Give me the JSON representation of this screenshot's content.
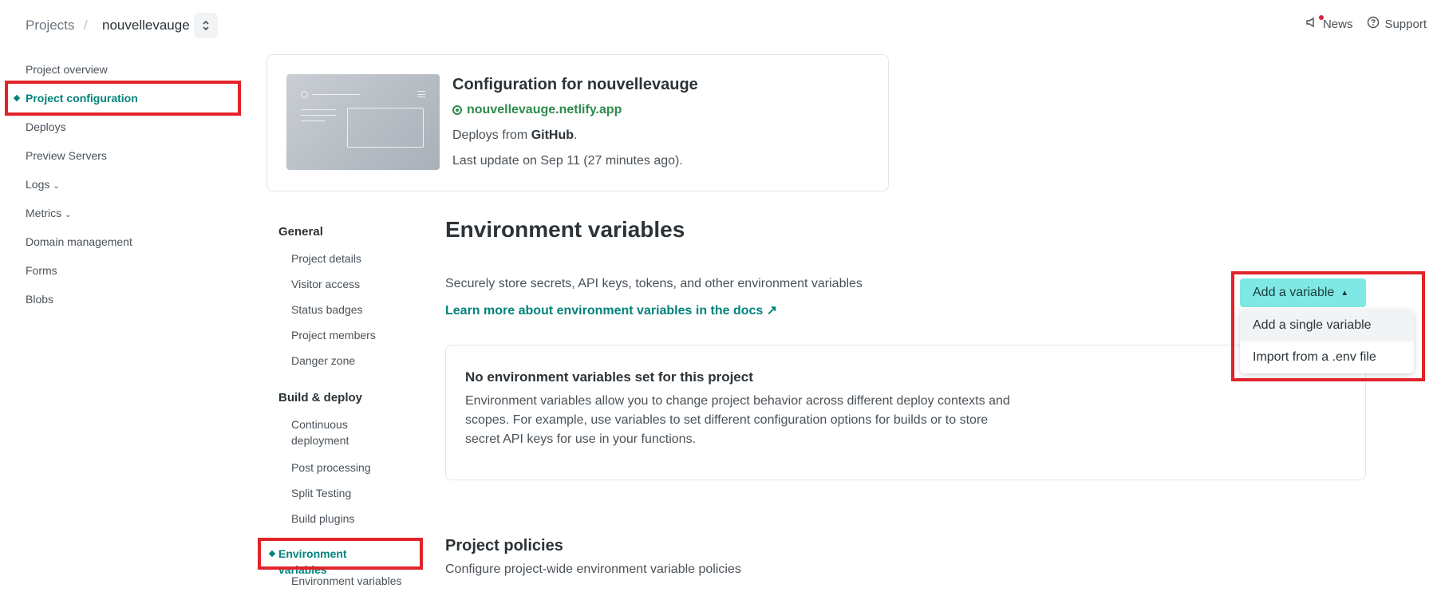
{
  "breadcrumb": {
    "projects": "Projects",
    "separator": "/",
    "site": "nouvellevauge",
    "switch_icon": "chevron-up-down-icon"
  },
  "top_links": {
    "news": "News",
    "support": "Support"
  },
  "leftnav": {
    "items": [
      {
        "label": "Project overview",
        "active": false
      },
      {
        "label": "Project configuration",
        "active": true
      },
      {
        "label": "Deploys",
        "active": false
      },
      {
        "label": "Preview Servers",
        "active": false
      },
      {
        "label": "Logs",
        "active": false,
        "expandable": true
      },
      {
        "label": "Metrics",
        "active": false,
        "expandable": true
      },
      {
        "label": "Domain management",
        "active": false
      },
      {
        "label": "Forms",
        "active": false
      },
      {
        "label": "Blobs",
        "active": false
      }
    ]
  },
  "site_card": {
    "title": "Configuration for nouvellevauge",
    "url": "nouvellevauge.netlify.app",
    "deploys_prefix": "Deploys from ",
    "deploys_source": "GitHub",
    "deploys_suffix": ".",
    "last_update": "Last update on Sep 11 (27 minutes ago)."
  },
  "subnav": {
    "general_heading": "General",
    "general_items": [
      "Project details",
      "Visitor access",
      "Status badges",
      "Project members",
      "Danger zone"
    ],
    "build_heading": "Build & deploy",
    "build_items": [
      "Continuous deployment",
      "Post processing",
      "Split Testing",
      "Build plugins"
    ],
    "active_item": "Environment variables",
    "child_item": "Environment variables"
  },
  "main": {
    "title": "Environment variables",
    "description": "Securely store secrets, API keys, tokens, and other environment variables",
    "docs_link": "Learn more about environment variables in the docs ↗",
    "empty_title": "No environment variables set for this project",
    "empty_text": "Environment variables allow you to change project behavior across different deploy contexts and scopes. For example, use variables to set different configuration options for builds or to store secret API keys for use in your functions.",
    "policies_title": "Project policies",
    "policies_desc": "Configure project-wide environment variable policies"
  },
  "add_variable": {
    "button_label": "Add a variable",
    "options": [
      "Add a single variable",
      "Import from a .env file"
    ],
    "expanded": true
  },
  "colors": {
    "accent": "#00827c",
    "button": "#7fe8e5",
    "highlight": "#e2232a",
    "live": "#2e8a4c"
  }
}
